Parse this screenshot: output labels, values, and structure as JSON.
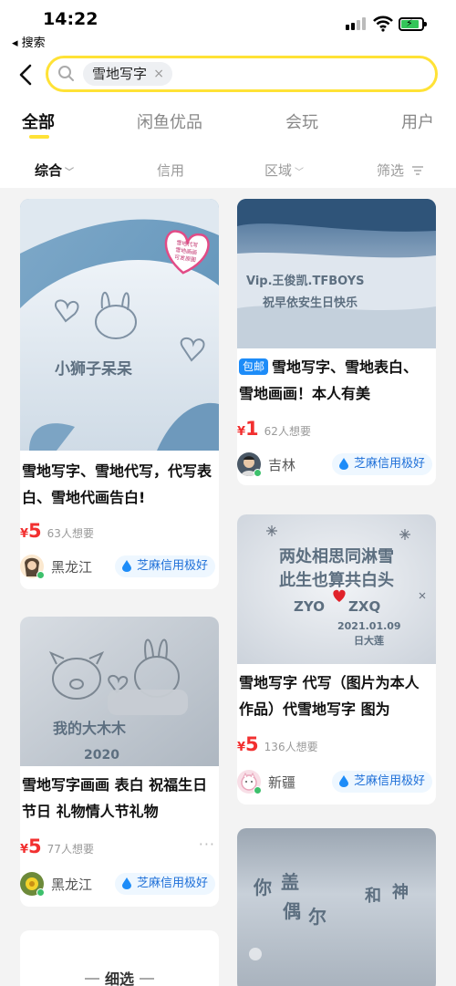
{
  "status_bar": {
    "time": "14:22",
    "back_app": "◂ 搜索"
  },
  "search": {
    "query": "雪地写字"
  },
  "tabs": [
    {
      "label": "全部",
      "active": true
    },
    {
      "label": "闲鱼优品"
    },
    {
      "label": "会玩"
    },
    {
      "label": "用户"
    }
  ],
  "filters": [
    {
      "label": "综合",
      "active": true
    },
    {
      "label": "信用"
    },
    {
      "label": "区域"
    },
    {
      "label": "筛选"
    }
  ],
  "cards": [
    {
      "title": "雪地写字、雪地代写，代写表白、雪地代画告白!",
      "price": "5",
      "want": "63人想要",
      "region": "黑龙江",
      "credit": "芝麻信用极好",
      "snow_text": [
        "小狮子呆呆"
      ],
      "sticker": [
        "雪地代写",
        "雪地画画",
        "可发原图"
      ]
    },
    {
      "tag": "包邮",
      "title": "雪地写字、雪地表白、雪地画画！本人有美",
      "price": "1",
      "want": "62人想要",
      "region": "吉林",
      "credit": "芝麻信用极好",
      "snow_text": [
        "Vip.王俊凯.TFBOYS",
        "祝早依安生日快乐"
      ]
    },
    {
      "title": "雪地写字 代写（图片为本人作品）代雪地写字 图为",
      "price": "5",
      "want": "136人想要",
      "region": "新疆",
      "credit": "芝麻信用极好",
      "snow_text": [
        "两处相思同淋雪",
        "此生也算共白头",
        "ZYO",
        "ZXQ",
        "2021.01.09",
        "日大莲"
      ]
    },
    {
      "title": "雪地写字画画 表白 祝福生日 节日 礼物情人节礼物",
      "price": "5",
      "want": "77人想要",
      "region": "黑龙江",
      "credit": "芝麻信用极好",
      "more": "···",
      "snow_text": [
        "我的大木木",
        "2020"
      ]
    },
    {
      "snow_text": [
        "你",
        "盖",
        "偶",
        "尔",
        "和",
        "神"
      ]
    }
  ],
  "refine": {
    "label": "细选"
  },
  "colors": {
    "accent": "#ffe236",
    "price": "#f23030",
    "credit": "#1d6fd8",
    "tag": "#1d8cf8"
  }
}
